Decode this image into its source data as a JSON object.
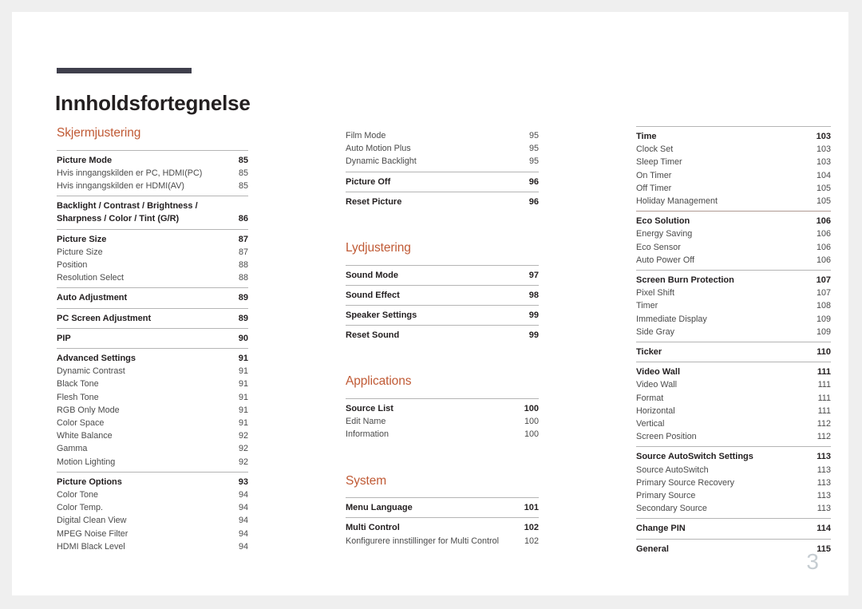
{
  "document": {
    "title": "Innholdsfortegnelse",
    "page_number": "3",
    "accent_color": "#c05a35",
    "rule_color": "#3f3f4c"
  },
  "columns": [
    {
      "id": "column-1",
      "sections": [
        {
          "heading": "Skjermjustering",
          "groups": [
            {
              "entries": [
                {
                  "level": 1,
                  "label": "Picture Mode",
                  "page": "85"
                },
                {
                  "level": 2,
                  "label": "Hvis inngangskilden er PC, HDMI(PC)",
                  "page": "85"
                },
                {
                  "level": 2,
                  "label": "Hvis inngangskilden er HDMI(AV)",
                  "page": "85"
                }
              ]
            },
            {
              "entries": [
                {
                  "level": 1,
                  "wrap": true,
                  "label": "Backlight / Contrast / Brightness / Sharpness / Color / Tint (G/R)",
                  "page": "86"
                }
              ]
            },
            {
              "entries": [
                {
                  "level": 1,
                  "label": "Picture Size",
                  "page": "87"
                },
                {
                  "level": 2,
                  "label": "Picture Size",
                  "page": "87"
                },
                {
                  "level": 2,
                  "label": "Position",
                  "page": "88"
                },
                {
                  "level": 2,
                  "label": "Resolution Select",
                  "page": "88"
                }
              ]
            },
            {
              "entries": [
                {
                  "level": 1,
                  "label": "Auto Adjustment",
                  "page": "89"
                }
              ]
            },
            {
              "entries": [
                {
                  "level": 1,
                  "label": "PC Screen Adjustment",
                  "page": "89"
                }
              ]
            },
            {
              "entries": [
                {
                  "level": 1,
                  "label": "PIP",
                  "page": "90"
                }
              ]
            },
            {
              "entries": [
                {
                  "level": 1,
                  "label": "Advanced Settings",
                  "page": "91"
                },
                {
                  "level": 2,
                  "label": "Dynamic Contrast",
                  "page": "91"
                },
                {
                  "level": 2,
                  "label": "Black Tone",
                  "page": "91"
                },
                {
                  "level": 2,
                  "label": "Flesh Tone",
                  "page": "91"
                },
                {
                  "level": 2,
                  "label": "RGB Only Mode",
                  "page": "91"
                },
                {
                  "level": 2,
                  "label": "Color Space",
                  "page": "91"
                },
                {
                  "level": 2,
                  "label": "White Balance",
                  "page": "92"
                },
                {
                  "level": 2,
                  "label": "Gamma",
                  "page": "92"
                },
                {
                  "level": 2,
                  "label": "Motion Lighting",
                  "page": "92"
                }
              ]
            },
            {
              "entries": [
                {
                  "level": 1,
                  "label": "Picture Options",
                  "page": "93"
                },
                {
                  "level": 2,
                  "label": "Color Tone",
                  "page": "94"
                },
                {
                  "level": 2,
                  "label": "Color Temp.",
                  "page": "94"
                },
                {
                  "level": 2,
                  "label": "Digital Clean View",
                  "page": "94"
                },
                {
                  "level": 2,
                  "label": "MPEG Noise Filter",
                  "page": "94"
                },
                {
                  "level": 2,
                  "label": "HDMI Black Level",
                  "page": "94"
                }
              ]
            }
          ]
        }
      ]
    },
    {
      "id": "column-2",
      "sections": [
        {
          "heading": "",
          "groups": [
            {
              "no_rule": true,
              "entries": [
                {
                  "level": 2,
                  "label": "Film Mode",
                  "page": "95"
                },
                {
                  "level": 2,
                  "label": "Auto Motion Plus",
                  "page": "95"
                },
                {
                  "level": 2,
                  "label": "Dynamic Backlight",
                  "page": "95"
                }
              ]
            },
            {
              "entries": [
                {
                  "level": 1,
                  "label": "Picture Off",
                  "page": "96"
                }
              ]
            },
            {
              "entries": [
                {
                  "level": 1,
                  "label": "Reset Picture",
                  "page": "96"
                }
              ]
            }
          ]
        },
        {
          "heading": "Lydjustering",
          "groups": [
            {
              "entries": [
                {
                  "level": 1,
                  "label": "Sound Mode",
                  "page": "97"
                }
              ]
            },
            {
              "entries": [
                {
                  "level": 1,
                  "label": "Sound Effect",
                  "page": "98"
                }
              ]
            },
            {
              "entries": [
                {
                  "level": 1,
                  "label": "Speaker Settings",
                  "page": "99"
                }
              ]
            },
            {
              "entries": [
                {
                  "level": 1,
                  "label": "Reset Sound",
                  "page": "99"
                }
              ]
            }
          ]
        },
        {
          "heading": "Applications",
          "groups": [
            {
              "entries": [
                {
                  "level": 1,
                  "label": "Source List",
                  "page": "100"
                },
                {
                  "level": 2,
                  "label": "Edit Name",
                  "page": "100"
                },
                {
                  "level": 2,
                  "label": "Information",
                  "page": "100"
                }
              ]
            }
          ]
        },
        {
          "heading": "System",
          "groups": [
            {
              "entries": [
                {
                  "level": 1,
                  "label": "Menu Language",
                  "page": "101"
                }
              ]
            },
            {
              "entries": [
                {
                  "level": 1,
                  "label": "Multi Control",
                  "page": "102"
                },
                {
                  "level": 2,
                  "label": "Konfigurere innstillinger for Multi Control",
                  "page": "102"
                }
              ]
            }
          ]
        }
      ]
    },
    {
      "id": "column-3",
      "sections": [
        {
          "heading": "",
          "groups": [
            {
              "entries": [
                {
                  "level": 1,
                  "label": "Time",
                  "page": "103"
                },
                {
                  "level": 2,
                  "label": "Clock Set",
                  "page": "103"
                },
                {
                  "level": 2,
                  "label": "Sleep Timer",
                  "page": "103"
                },
                {
                  "level": 2,
                  "label": "On Timer",
                  "page": "104"
                },
                {
                  "level": 2,
                  "label": "Off Timer",
                  "page": "105"
                },
                {
                  "level": 2,
                  "label": "Holiday Management",
                  "page": "105"
                }
              ]
            },
            {
              "warm_rule": true,
              "entries": [
                {
                  "level": 1,
                  "label": "Eco Solution",
                  "page": "106"
                },
                {
                  "level": 2,
                  "label": "Energy Saving",
                  "page": "106"
                },
                {
                  "level": 2,
                  "label": "Eco Sensor",
                  "page": "106"
                },
                {
                  "level": 2,
                  "label": "Auto Power Off",
                  "page": "106"
                }
              ]
            },
            {
              "entries": [
                {
                  "level": 1,
                  "label": "Screen Burn Protection",
                  "page": "107"
                },
                {
                  "level": 2,
                  "label": "Pixel Shift",
                  "page": "107"
                },
                {
                  "level": 2,
                  "label": "Timer",
                  "page": "108"
                },
                {
                  "level": 2,
                  "label": "Immediate Display",
                  "page": "109"
                },
                {
                  "level": 2,
                  "label": "Side Gray",
                  "page": "109"
                }
              ]
            },
            {
              "entries": [
                {
                  "level": 1,
                  "label": "Ticker",
                  "page": "110"
                }
              ]
            },
            {
              "entries": [
                {
                  "level": 1,
                  "label": "Video Wall",
                  "page": "111"
                },
                {
                  "level": 2,
                  "label": "Video Wall",
                  "page": "111"
                },
                {
                  "level": 2,
                  "label": "Format",
                  "page": "111"
                },
                {
                  "level": 2,
                  "label": "Horizontal",
                  "page": "111"
                },
                {
                  "level": 2,
                  "label": "Vertical",
                  "page": "112"
                },
                {
                  "level": 2,
                  "label": "Screen Position",
                  "page": "112"
                }
              ]
            },
            {
              "entries": [
                {
                  "level": 1,
                  "label": "Source AutoSwitch Settings",
                  "page": "113"
                },
                {
                  "level": 2,
                  "label": "Source AutoSwitch",
                  "page": "113"
                },
                {
                  "level": 2,
                  "label": "Primary Source Recovery",
                  "page": "113"
                },
                {
                  "level": 2,
                  "label": "Primary Source",
                  "page": "113"
                },
                {
                  "level": 2,
                  "label": "Secondary Source",
                  "page": "113"
                }
              ]
            },
            {
              "entries": [
                {
                  "level": 1,
                  "label": "Change PIN",
                  "page": "114"
                }
              ]
            },
            {
              "entries": [
                {
                  "level": 1,
                  "label": "General",
                  "page": "115"
                }
              ]
            }
          ]
        }
      ]
    }
  ]
}
